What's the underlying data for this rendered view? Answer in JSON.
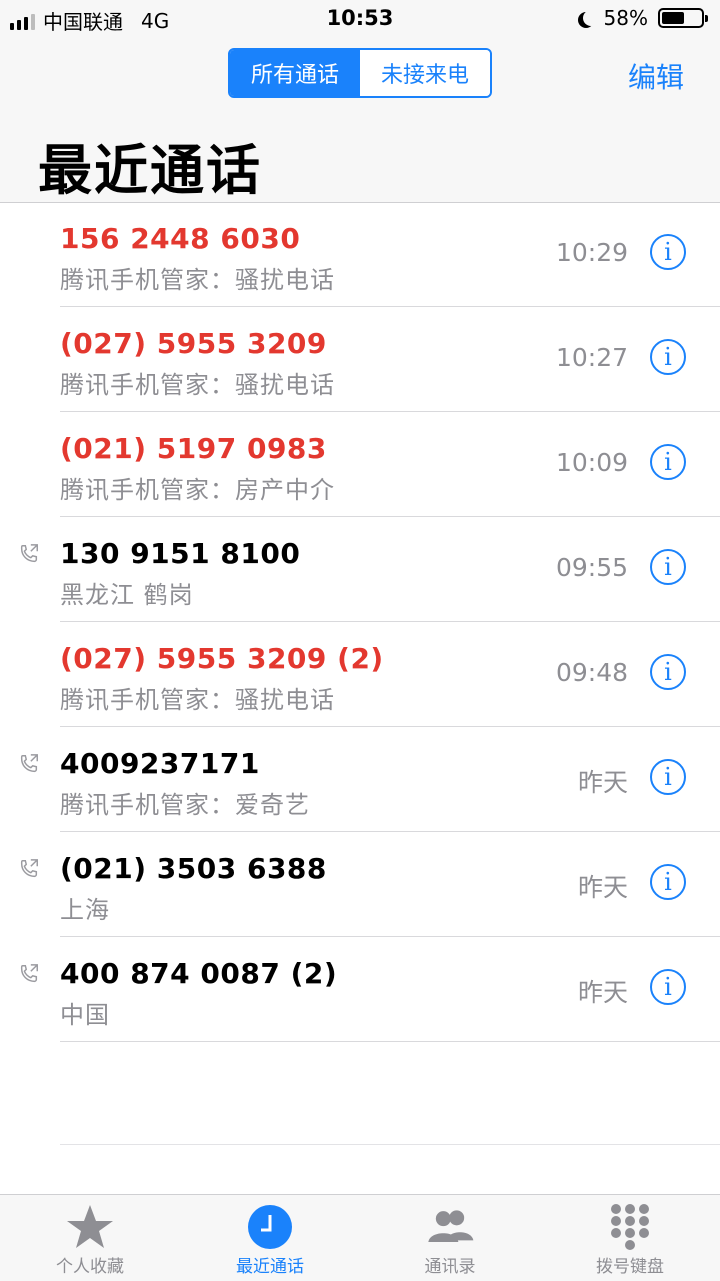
{
  "status_bar": {
    "carrier": "中国联通",
    "network": "4G",
    "time": "10:53",
    "battery": "58%",
    "battery_level": 0.58
  },
  "header": {
    "segments": [
      {
        "label": "所有通话",
        "selected": true
      },
      {
        "label": "未接来电",
        "selected": false
      }
    ],
    "edit_label": "编辑",
    "title": "最近通话"
  },
  "calls": [
    {
      "number": "156 2448 6030",
      "label": "腾讯手机管家：骚扰电话",
      "time": "10:29",
      "missed": true,
      "outgoing": false
    },
    {
      "number": "(027) 5955 3209",
      "label": "腾讯手机管家：骚扰电话",
      "time": "10:27",
      "missed": true,
      "outgoing": false
    },
    {
      "number": "(021) 5197 0983",
      "label": "腾讯手机管家：房产中介",
      "time": "10:09",
      "missed": true,
      "outgoing": false
    },
    {
      "number": "130 9151 8100",
      "label": "黑龙江 鹤岗",
      "time": "09:55",
      "missed": false,
      "outgoing": true
    },
    {
      "number": "(027) 5955 3209 (2)",
      "label": "腾讯手机管家：骚扰电话",
      "time": "09:48",
      "missed": true,
      "outgoing": false
    },
    {
      "number": "4009237171",
      "label": "腾讯手机管家：爱奇艺",
      "time": "昨天",
      "missed": false,
      "outgoing": true
    },
    {
      "number": "(021) 3503 6388",
      "label": "上海",
      "time": "昨天",
      "missed": false,
      "outgoing": true
    },
    {
      "number": "400 874 0087 (2)",
      "label": "中国",
      "time": "昨天",
      "missed": false,
      "outgoing": true
    }
  ],
  "info_glyph": "i",
  "tabs": [
    {
      "label": "个人收藏",
      "icon": "star-icon",
      "active": false
    },
    {
      "label": "最近通话",
      "icon": "clock-icon",
      "active": true
    },
    {
      "label": "通讯录",
      "icon": "contacts-icon",
      "active": false
    },
    {
      "label": "拨号键盘",
      "icon": "keypad-icon",
      "active": false
    }
  ],
  "colors": {
    "accent": "#1a82fb",
    "missed": "#e3382f",
    "secondary_text": "#8e8e93"
  }
}
